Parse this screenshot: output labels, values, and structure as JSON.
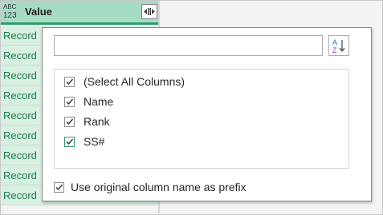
{
  "column_header": {
    "type_icon_top": "ABC",
    "type_icon_bottom": "123",
    "title": "Value",
    "expand_icon": "expand-columns-icon"
  },
  "record_cells": [
    "Record",
    "Record",
    "Record",
    "Record",
    "Record",
    "Record",
    "Record",
    "Record",
    "Record"
  ],
  "expand_panel": {
    "search": {
      "value": "",
      "placeholder": ""
    },
    "sort_icon": "sort-az-icon",
    "columns": [
      {
        "label": "(Select All Columns)",
        "checked": true
      },
      {
        "label": "Name",
        "checked": true
      },
      {
        "label": "Rank",
        "checked": true
      },
      {
        "label": "SS#",
        "checked": true
      }
    ],
    "use_prefix": {
      "label": "Use original column name as prefix",
      "checked": true
    }
  },
  "colors": {
    "header_bg": "#a7dcc4",
    "header_underline": "#2f9c6c",
    "record_bg": "#d8efe2",
    "record_text": "#1a7d4a"
  }
}
